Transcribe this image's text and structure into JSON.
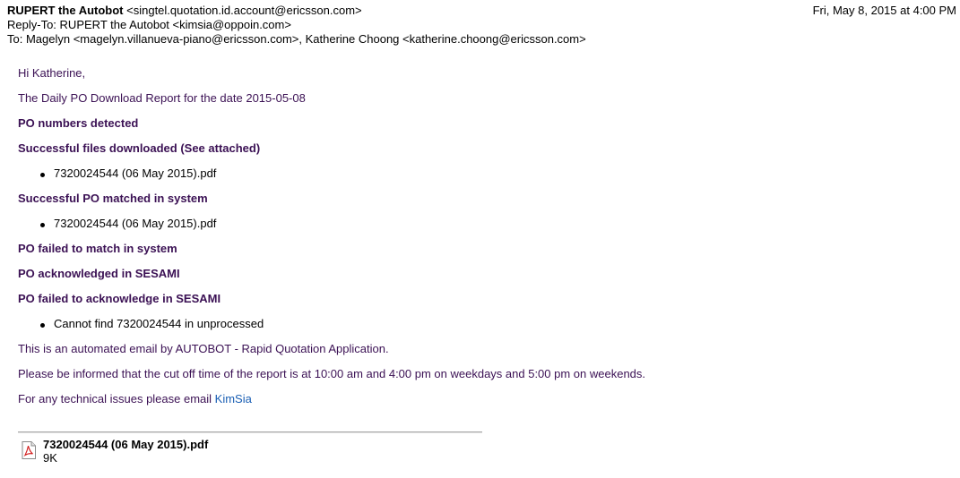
{
  "header": {
    "from_name": "RUPERT the Autobot",
    "from_email": "<singtel.quotation.id.account@ericsson.com>",
    "date": "Fri, May 8, 2015 at 4:00 PM",
    "reply_to_label": "Reply-To:",
    "reply_to_value": "RUPERT the Autobot <kimsia@oppoin.com>",
    "to_label": "To:",
    "to_value": "Magelyn <magelyn.villanueva-piano@ericsson.com>, Katherine Choong <katherine.choong@ericsson.com>"
  },
  "body": {
    "greeting": "Hi Katherine,",
    "intro": "The Daily PO Download Report for the date 2015-05-08",
    "po_detected": "PO numbers detected",
    "downloaded_heading": "Successful files downloaded (See attached)",
    "downloaded_items": [
      "7320024544 (06 May 2015).pdf"
    ],
    "matched_heading": "Successful PO matched in system",
    "matched_items": [
      "7320024544 (06 May 2015).pdf"
    ],
    "failed_match_heading": "PO failed to match in system",
    "acknowledged_heading": "PO acknowledged in SESAMI",
    "failed_ack_heading": "PO failed to acknowledge in SESAMI",
    "failed_ack_items": [
      "Cannot find 7320024544 in unprocessed"
    ],
    "automated_note": "This is an automated email by AUTOBOT - Rapid Quotation Application.",
    "cutoff_note": "Please be informed that the cut off time of the report is at 10:00 am and 4:00 pm on weekdays and 5:00 pm on weekends.",
    "support_prefix": "For any technical issues please email ",
    "support_link": "KimSia"
  },
  "attachment": {
    "name": "7320024544 (06 May 2015).pdf",
    "size": "9K",
    "icon": "pdf-file-icon"
  },
  "colors": {
    "body_text": "#3b1154",
    "link": "#1a5fb4",
    "pdf_red": "#d21a1a"
  }
}
